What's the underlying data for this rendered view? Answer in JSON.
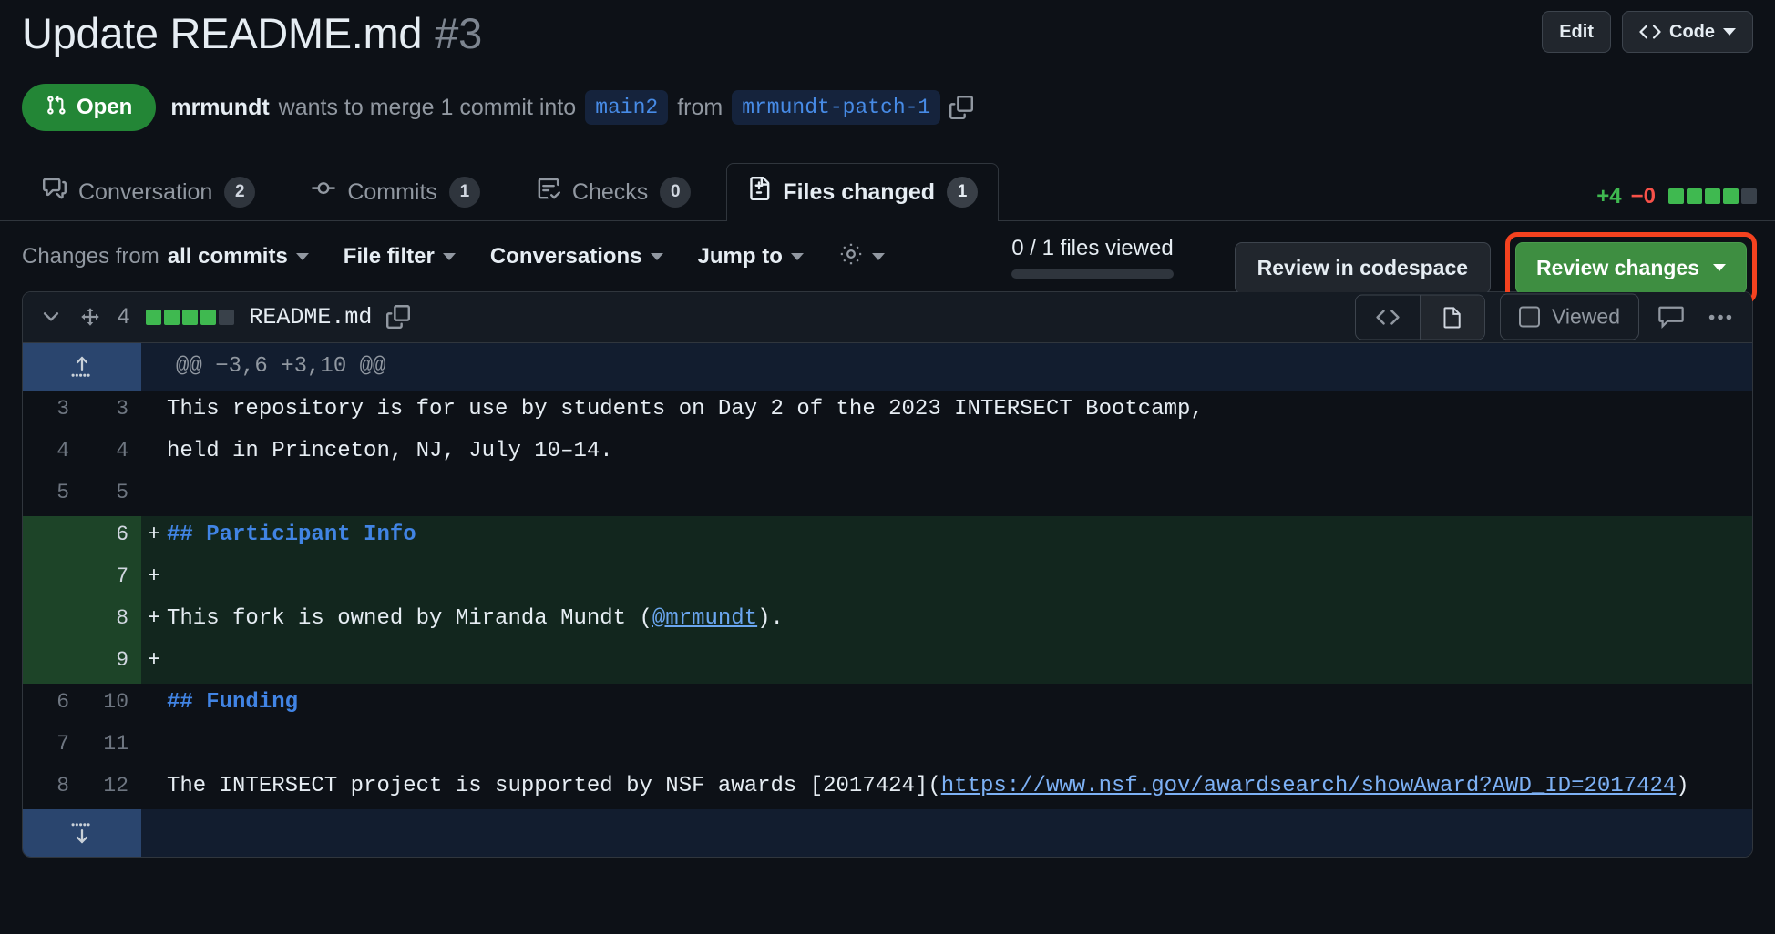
{
  "header": {
    "title": "Update README.md",
    "number": "#3",
    "edit_label": "Edit",
    "code_label": "Code"
  },
  "status": {
    "state_label": "Open",
    "author": "mrmundt",
    "text_before": "wants to merge 1 commit into",
    "base_branch": "main2",
    "text_middle": "from",
    "head_branch": "mrmundt-patch-1"
  },
  "tabs": [
    {
      "label": "Conversation",
      "count": "2",
      "icon": "comment-discussion-icon",
      "active": false
    },
    {
      "label": "Commits",
      "count": "1",
      "icon": "git-commit-icon",
      "active": false
    },
    {
      "label": "Checks",
      "count": "0",
      "icon": "checklist-icon",
      "active": false
    },
    {
      "label": "Files changed",
      "count": "1",
      "icon": "file-diff-icon",
      "active": true
    }
  ],
  "diffstat": {
    "additions": "+4",
    "deletions": "−0",
    "squares": [
      "g",
      "g",
      "g",
      "g",
      "n"
    ]
  },
  "toolbar": {
    "changes_from_prefix": "Changes from",
    "changes_from_value": "all commits",
    "file_filter": "File filter",
    "conversations": "Conversations",
    "jump_to": "Jump to",
    "gear_icon": "gear-icon",
    "files_viewed": "0 / 1 files viewed",
    "review_codespace": "Review in codespace",
    "review_changes": "Review changes",
    "highlight_color": "#f4421f",
    "review_button_color": "#3e8e41"
  },
  "file": {
    "change_count": "4",
    "name": "README.md",
    "squares": [
      "g",
      "g",
      "g",
      "g",
      "n"
    ],
    "viewed_label": "Viewed",
    "copy_icon": "copy-icon",
    "code_view_icon": "code-icon",
    "file_view_icon": "file-icon",
    "comment_icon": "comment-icon",
    "more_icon": "kebab-icon"
  },
  "diff": {
    "hunk_header": "@@ −3,6 +3,10 @@",
    "expand_up_icon": "expand-up-icon",
    "expand_down_icon": "expand-down-icon",
    "rows": [
      {
        "type": "ctx",
        "old": "3",
        "new": "3",
        "marker": "",
        "text": "This repository is for use by students on Day 2 of the 2023 INTERSECT Bootcamp,"
      },
      {
        "type": "ctx",
        "old": "4",
        "new": "4",
        "marker": "",
        "text": "held in Princeton, NJ, July 10–14."
      },
      {
        "type": "ctx",
        "old": "5",
        "new": "5",
        "marker": "",
        "text": ""
      },
      {
        "type": "add",
        "old": "",
        "new": "6",
        "marker": "+",
        "text": "## Participant Info",
        "style": "heading"
      },
      {
        "type": "add",
        "old": "",
        "new": "7",
        "marker": "+",
        "text": ""
      },
      {
        "type": "add",
        "old": "",
        "new": "8",
        "marker": "+",
        "text": "This fork is owned by Miranda Mundt (@mrmundt).",
        "style": "mention",
        "mention": "@mrmundt",
        "prefix": "This fork is owned by Miranda Mundt (",
        "suffix": ")."
      },
      {
        "type": "add",
        "old": "",
        "new": "9",
        "marker": "+",
        "text": ""
      },
      {
        "type": "ctx",
        "old": "6",
        "new": "10",
        "marker": "",
        "text": "## Funding",
        "style": "heading"
      },
      {
        "type": "ctx",
        "old": "7",
        "new": "11",
        "marker": "",
        "text": ""
      },
      {
        "type": "ctx",
        "old": "8",
        "new": "12",
        "marker": "",
        "text": "The INTERSECT project is supported by NSF awards [2017424](https://www.nsf.gov/awardsearch/showAward?AWD_ID=2017424)",
        "style": "link",
        "prefix": "The INTERSECT project is supported by NSF awards [2017424](",
        "link": "https://www.nsf.gov/awardsearch/showAward?AWD_ID=2017424",
        "suffix": ")"
      }
    ]
  }
}
